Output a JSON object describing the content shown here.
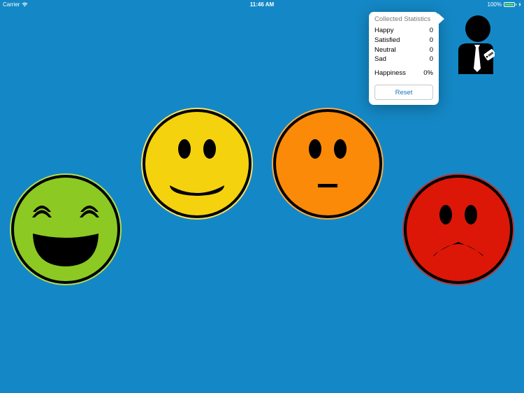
{
  "status_bar": {
    "carrier": "Carrier",
    "time": "11:46 AM",
    "battery": "100%"
  },
  "faces": [
    {
      "id": "happy",
      "color": "#8dc923",
      "ring": "#b4df4e"
    },
    {
      "id": "satisfied",
      "color": "#f5d20e",
      "ring": "#f9e462"
    },
    {
      "id": "neutral",
      "color": "#fb8a08",
      "ring": "#f7ad4c"
    },
    {
      "id": "sad",
      "color": "#dc1708",
      "ring": "#b8343a"
    }
  ],
  "statistics": {
    "title": "Collected Statistics",
    "rows": [
      {
        "label": "Happy",
        "value": "0"
      },
      {
        "label": "Satisfied",
        "value": "0"
      },
      {
        "label": "Neutral",
        "value": "0"
      },
      {
        "label": "Sad",
        "value": "0"
      }
    ],
    "happiness_label": "Happiness",
    "happiness_value": "0%",
    "reset_label": "Reset"
  },
  "icons": {
    "admin": "businessman-icon",
    "wifi": "wifi-icon",
    "battery": "battery-icon"
  }
}
